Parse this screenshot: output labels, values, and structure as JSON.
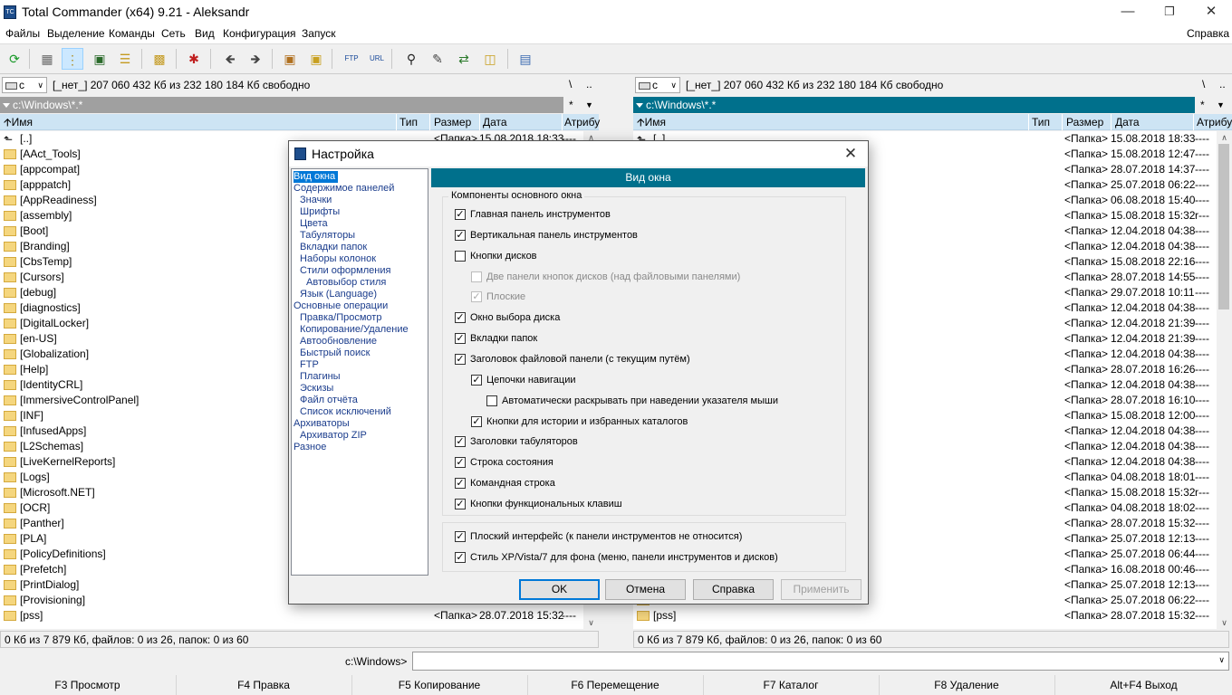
{
  "window": {
    "title": "Total Commander (x64) 9.21 - Aleksandr",
    "icon_text": "TC"
  },
  "menu": {
    "items": [
      "Файлы",
      "Выделение",
      "Команды",
      "Сеть",
      "Вид",
      "Конфигурация",
      "Запуск"
    ],
    "help": "Справка"
  },
  "toolbar": {
    "icons": [
      "refresh-icon",
      "brief-view-icon",
      "full-view-icon",
      "thumbnails-icon",
      "tree-icon",
      "select-files-icon",
      "invert-selection-icon",
      "back-icon",
      "forward-icon",
      "pack-icon",
      "unpack-icon",
      "ftp-connect-icon",
      "url-connect-icon",
      "search-icon",
      "multi-rename-icon",
      "sync-dirs-icon",
      "copy-names-icon",
      "notepad-icon"
    ]
  },
  "left_panel": {
    "drive": "c",
    "drive_info": "[_нет_]  207 060 432 Кб из 232 180 184 Кб свободно",
    "root_btn": "\\",
    "up_btn": "..",
    "path": "c:\\Windows\\*.*",
    "star": "*",
    "columns": {
      "name": "Имя",
      "ext": "Тип",
      "size": "Размер",
      "date": "Дата",
      "attr": "Атрибу"
    },
    "files": [
      {
        "name": "[..]",
        "size": "<Папка>",
        "date": "15.08.2018 18:33",
        "attr": "----"
      },
      {
        "name": "[AAct_Tools]"
      },
      {
        "name": "[appcompat]"
      },
      {
        "name": "[apppatch]"
      },
      {
        "name": "[AppReadiness]"
      },
      {
        "name": "[assembly]"
      },
      {
        "name": "[Boot]"
      },
      {
        "name": "[Branding]"
      },
      {
        "name": "[CbsTemp]"
      },
      {
        "name": "[Cursors]"
      },
      {
        "name": "[debug]"
      },
      {
        "name": "[diagnostics]"
      },
      {
        "name": "[DigitalLocker]"
      },
      {
        "name": "[en-US]"
      },
      {
        "name": "[Globalization]"
      },
      {
        "name": "[Help]"
      },
      {
        "name": "[IdentityCRL]"
      },
      {
        "name": "[ImmersiveControlPanel]"
      },
      {
        "name": "[INF]"
      },
      {
        "name": "[InfusedApps]"
      },
      {
        "name": "[L2Schemas]"
      },
      {
        "name": "[LiveKernelReports]"
      },
      {
        "name": "[Logs]"
      },
      {
        "name": "[Microsoft.NET]"
      },
      {
        "name": "[OCR]"
      },
      {
        "name": "[Panther]"
      },
      {
        "name": "[PLA]"
      },
      {
        "name": "[PolicyDefinitions]"
      },
      {
        "name": "[Prefetch]"
      },
      {
        "name": "[PrintDialog]"
      },
      {
        "name": "[Provisioning]"
      },
      {
        "name": "[pss]",
        "size": "<Папка>",
        "date": "28.07.2018 15:32",
        "attr": "----"
      }
    ],
    "status": "0 Кб из 7 879 Кб, файлов: 0 из 26, папок: 0 из 60",
    "scroll": {
      "start": 0.0,
      "size": 0.35
    }
  },
  "right_panel": {
    "drive": "c",
    "drive_info": "[_нет_]  207 060 432 Кб из 232 180 184 Кб свободно",
    "root_btn": "\\",
    "up_btn": "..",
    "path": "c:\\Windows\\*.*",
    "star": "*",
    "columns": {
      "name": "Имя",
      "ext": "Тип",
      "size": "Размер",
      "date": "Дата",
      "attr": "Атрибу"
    },
    "files": [
      {
        "name": "[..]",
        "size": "<Папка>",
        "date": "15.08.2018 18:33",
        "attr": "----"
      },
      {
        "name": "",
        "size": "<Папка>",
        "date": "15.08.2018 12:47",
        "attr": "----"
      },
      {
        "name": "",
        "size": "<Папка>",
        "date": "28.07.2018 14:37",
        "attr": "----"
      },
      {
        "name": "",
        "size": "<Папка>",
        "date": "25.07.2018 06:22",
        "attr": "----"
      },
      {
        "name": "",
        "size": "<Папка>",
        "date": "06.08.2018 15:40",
        "attr": "----"
      },
      {
        "name": "",
        "size": "<Папка>",
        "date": "15.08.2018 15:32",
        "attr": "r---"
      },
      {
        "name": "",
        "size": "<Папка>",
        "date": "12.04.2018 04:38",
        "attr": "----"
      },
      {
        "name": "",
        "size": "<Папка>",
        "date": "12.04.2018 04:38",
        "attr": "----"
      },
      {
        "name": "",
        "size": "<Папка>",
        "date": "15.08.2018 22:16",
        "attr": "----"
      },
      {
        "name": "",
        "size": "<Папка>",
        "date": "28.07.2018 14:55",
        "attr": "----"
      },
      {
        "name": "",
        "size": "<Папка>",
        "date": "29.07.2018 10:11",
        "attr": "----"
      },
      {
        "name": "",
        "size": "<Папка>",
        "date": "12.04.2018 04:38",
        "attr": "----"
      },
      {
        "name": "",
        "size": "<Папка>",
        "date": "12.04.2018 21:39",
        "attr": "----"
      },
      {
        "name": "",
        "size": "<Папка>",
        "date": "12.04.2018 21:39",
        "attr": "----"
      },
      {
        "name": "",
        "size": "<Папка>",
        "date": "12.04.2018 04:38",
        "attr": "----"
      },
      {
        "name": "",
        "size": "<Папка>",
        "date": "28.07.2018 16:26",
        "attr": "----"
      },
      {
        "name": "",
        "size": "<Папка>",
        "date": "12.04.2018 04:38",
        "attr": "----"
      },
      {
        "name": "",
        "size": "<Папка>",
        "date": "28.07.2018 16:10",
        "attr": "----"
      },
      {
        "name": "",
        "size": "<Папка>",
        "date": "15.08.2018 12:00",
        "attr": "----"
      },
      {
        "name": "",
        "size": "<Папка>",
        "date": "12.04.2018 04:38",
        "attr": "----"
      },
      {
        "name": "",
        "size": "<Папка>",
        "date": "12.04.2018 04:38",
        "attr": "----"
      },
      {
        "name": "",
        "size": "<Папка>",
        "date": "12.04.2018 04:38",
        "attr": "----"
      },
      {
        "name": "",
        "size": "<Папка>",
        "date": "04.08.2018 18:01",
        "attr": "----"
      },
      {
        "name": "",
        "size": "<Папка>",
        "date": "15.08.2018 15:32",
        "attr": "r---"
      },
      {
        "name": "",
        "size": "<Папка>",
        "date": "04.08.2018 18:02",
        "attr": "----"
      },
      {
        "name": "",
        "size": "<Папка>",
        "date": "28.07.2018 15:32",
        "attr": "----"
      },
      {
        "name": "",
        "size": "<Папка>",
        "date": "25.07.2018 12:13",
        "attr": "----"
      },
      {
        "name": "",
        "size": "<Папка>",
        "date": "25.07.2018 06:44",
        "attr": "----"
      },
      {
        "name": "",
        "size": "<Папка>",
        "date": "16.08.2018 00:46",
        "attr": "----"
      },
      {
        "name": "",
        "size": "<Папка>",
        "date": "25.07.2018 12:13",
        "attr": "----"
      },
      {
        "name": "",
        "size": "<Папка>",
        "date": "25.07.2018 06:22",
        "attr": "----"
      },
      {
        "name": "[pss]",
        "size": "<Папка>",
        "date": "28.07.2018 15:32",
        "attr": "----"
      }
    ],
    "status": "0 Кб из 7 879 Кб, файлов: 0 из 26, папок: 0 из 60",
    "scroll": {
      "start": 0.0,
      "size": 0.35
    }
  },
  "cmdline": {
    "label": "c:\\Windows>",
    "value": ""
  },
  "fkeys": [
    "F3 Просмотр",
    "F4 Правка",
    "F5 Копирование",
    "F6 Перемещение",
    "F7 Каталог",
    "F8 Удаление",
    "Alt+F4 Выход"
  ],
  "dialog": {
    "title": "Настройка",
    "close": "✕",
    "tree": [
      {
        "label": "Вид окна",
        "level": 0,
        "selected": true
      },
      {
        "label": "Содержимое панелей",
        "level": 0
      },
      {
        "label": "Значки",
        "level": 1
      },
      {
        "label": "Шрифты",
        "level": 1
      },
      {
        "label": "Цвета",
        "level": 1
      },
      {
        "label": "Табуляторы",
        "level": 1
      },
      {
        "label": "Вкладки папок",
        "level": 1
      },
      {
        "label": "Наборы колонок",
        "level": 1
      },
      {
        "label": "Стили оформления",
        "level": 1
      },
      {
        "label": "Автовыбор стиля",
        "level": 2
      },
      {
        "label": "Язык (Language)",
        "level": 1
      },
      {
        "label": "Основные операции",
        "level": 0
      },
      {
        "label": "Правка/Просмотр",
        "level": 1
      },
      {
        "label": "Копирование/Удаление",
        "level": 1
      },
      {
        "label": "Автообновление",
        "level": 1
      },
      {
        "label": "Быстрый поиск",
        "level": 1
      },
      {
        "label": "FTP",
        "level": 1
      },
      {
        "label": "Плагины",
        "level": 1
      },
      {
        "label": "Эскизы",
        "level": 1
      },
      {
        "label": "Файл отчёта",
        "level": 1
      },
      {
        "label": "Список исключений",
        "level": 1
      },
      {
        "label": "Архиваторы",
        "level": 0
      },
      {
        "label": "Архиватор ZIP",
        "level": 1
      },
      {
        "label": "Разное",
        "level": 0
      }
    ],
    "section_title": "Вид окна",
    "group1_title": "Компоненты основного окна",
    "checkboxes": [
      {
        "label": "Главная панель инструментов",
        "checked": true,
        "enabled": true,
        "indent": 0
      },
      {
        "label": "Вертикальная панель инструментов",
        "checked": true,
        "enabled": true,
        "indent": 0
      },
      {
        "label": "Кнопки дисков",
        "checked": false,
        "enabled": true,
        "indent": 0
      },
      {
        "label": "Две панели кнопок дисков (над файловыми панелями)",
        "checked": false,
        "enabled": false,
        "indent": 1
      },
      {
        "label": "Плоские",
        "checked": true,
        "enabled": false,
        "indent": 1
      },
      {
        "label": "Окно выбора диска",
        "checked": true,
        "enabled": true,
        "indent": 0
      },
      {
        "label": "Вкладки папок",
        "checked": true,
        "enabled": true,
        "indent": 0
      },
      {
        "label": "Заголовок файловой панели (с текущим путём)",
        "checked": true,
        "enabled": true,
        "indent": 0
      },
      {
        "label": "Цепочки навигации",
        "checked": true,
        "enabled": true,
        "indent": 1
      },
      {
        "label": "Автоматически раскрывать при наведении указателя мыши",
        "checked": false,
        "enabled": true,
        "indent": 2
      },
      {
        "label": "Кнопки для истории и избранных каталогов",
        "checked": true,
        "enabled": true,
        "indent": 1
      },
      {
        "label": "Заголовки табуляторов",
        "checked": true,
        "enabled": true,
        "indent": 0
      },
      {
        "label": "Строка состояния",
        "checked": true,
        "enabled": true,
        "indent": 0
      },
      {
        "label": "Командная строка",
        "checked": true,
        "enabled": true,
        "indent": 0
      },
      {
        "label": "Кнопки функциональных клавиш",
        "checked": true,
        "enabled": true,
        "indent": 0
      }
    ],
    "checkboxes2": [
      {
        "label": "Плоский интерфейс (к панели инструментов не относится)",
        "checked": true,
        "enabled": true
      },
      {
        "label": "Стиль XP/Vista/7 для фона (меню, панели инструментов и дисков)",
        "checked": true,
        "enabled": true
      }
    ],
    "buttons": {
      "ok": "OK",
      "cancel": "Отмена",
      "help": "Справка",
      "apply": "Применить"
    }
  }
}
